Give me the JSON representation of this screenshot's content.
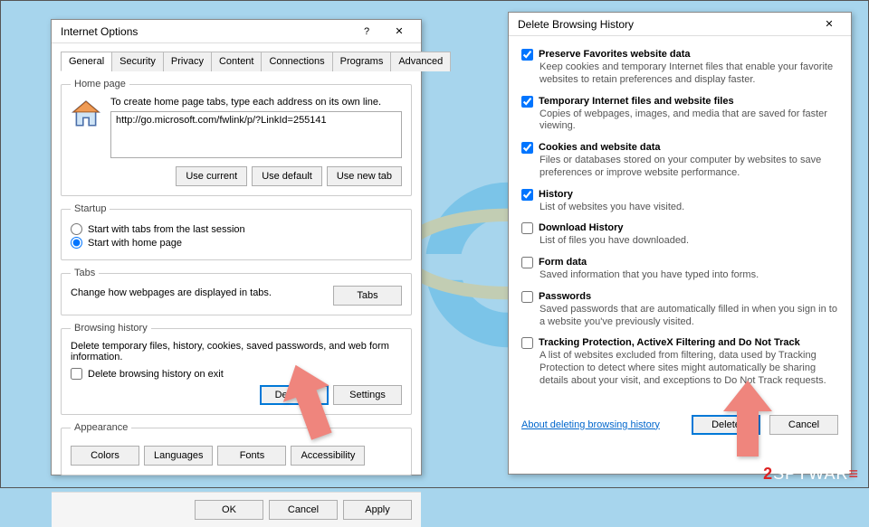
{
  "iopts": {
    "title": "Internet Options",
    "help_glyph": "?",
    "close_glyph": "✕",
    "tabs": [
      "General",
      "Security",
      "Privacy",
      "Content",
      "Connections",
      "Programs",
      "Advanced"
    ],
    "home": {
      "legend": "Home page",
      "desc": "To create home page tabs, type each address on its own line.",
      "url": "http://go.microsoft.com/fwlink/p/?LinkId=255141",
      "use_current": "Use current",
      "use_default": "Use default",
      "use_new": "Use new tab"
    },
    "startup": {
      "legend": "Startup",
      "opt_last": "Start with tabs from the last session",
      "opt_home": "Start with home page"
    },
    "tabs_group": {
      "legend": "Tabs",
      "desc": "Change how webpages are displayed in tabs.",
      "btn": "Tabs"
    },
    "history": {
      "legend": "Browsing history",
      "desc": "Delete temporary files, history, cookies, saved passwords, and web form information.",
      "chk": "Delete browsing history on exit",
      "delete": "Delete…",
      "settings": "Settings"
    },
    "appearance": {
      "legend": "Appearance",
      "colors": "Colors",
      "languages": "Languages",
      "fonts": "Fonts",
      "access": "Accessibility"
    },
    "footer": {
      "ok": "OK",
      "cancel": "Cancel",
      "apply": "Apply"
    }
  },
  "dbh": {
    "title": "Delete Browsing History",
    "close_glyph": "✕",
    "opts": {
      "preserve": {
        "label": "Preserve Favorites website data",
        "desc": "Keep cookies and temporary Internet files that enable your favorite websites to retain preferences and display faster.",
        "checked": true
      },
      "tempfiles": {
        "label": "Temporary Internet files and website files",
        "desc": "Copies of webpages, images, and media that are saved for faster viewing.",
        "checked": true
      },
      "cookies": {
        "label": "Cookies and website data",
        "desc": "Files or databases stored on your computer by websites to save preferences or improve website performance.",
        "checked": true
      },
      "history": {
        "label": "History",
        "desc": "List of websites you have visited.",
        "checked": true
      },
      "dlhist": {
        "label": "Download History",
        "desc": "List of files you have downloaded.",
        "checked": false
      },
      "form": {
        "label": "Form data",
        "desc": "Saved information that you have typed into forms.",
        "checked": false
      },
      "passwords": {
        "label": "Passwords",
        "desc": "Saved passwords that are automatically filled in when you sign in to a website you've previously visited.",
        "checked": false
      },
      "tracking": {
        "label": "Tracking Protection, ActiveX Filtering and Do Not Track",
        "desc": "A list of websites excluded from filtering, data used by Tracking Protection to detect where sites might automatically be sharing details about your visit, and exceptions to Do Not Track requests.",
        "checked": false
      }
    },
    "link": "About deleting browsing history",
    "delete": "Delete",
    "cancel": "Cancel"
  },
  "brand": "SPYWAR"
}
